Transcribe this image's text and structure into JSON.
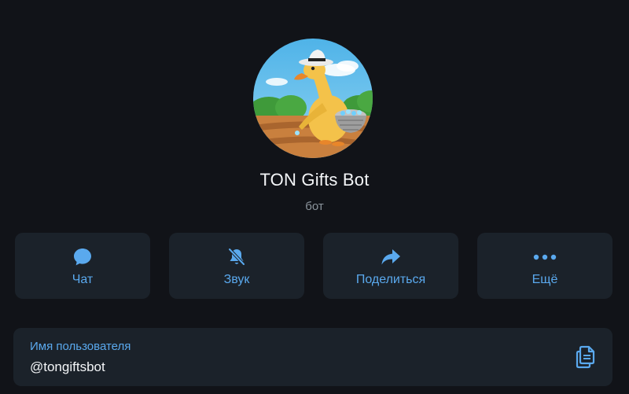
{
  "profile": {
    "name": "TON Gifts Bot",
    "subtitle": "бот"
  },
  "actions": [
    {
      "label": "Чат",
      "icon": "chat-bubble-icon"
    },
    {
      "label": "Звук",
      "icon": "bell-muted-icon"
    },
    {
      "label": "Поделиться",
      "icon": "share-arrow-icon"
    },
    {
      "label": "Ещё",
      "icon": "more-dots-icon"
    }
  ],
  "username": {
    "label": "Имя пользователя",
    "value": "@tongiftsbot",
    "copy_icon": "copy-icon"
  },
  "colors": {
    "background": "#111318",
    "card": "#1b222a",
    "accent": "#5aa9ee",
    "text": "#f4f6f8",
    "muted": "#8b949c"
  }
}
